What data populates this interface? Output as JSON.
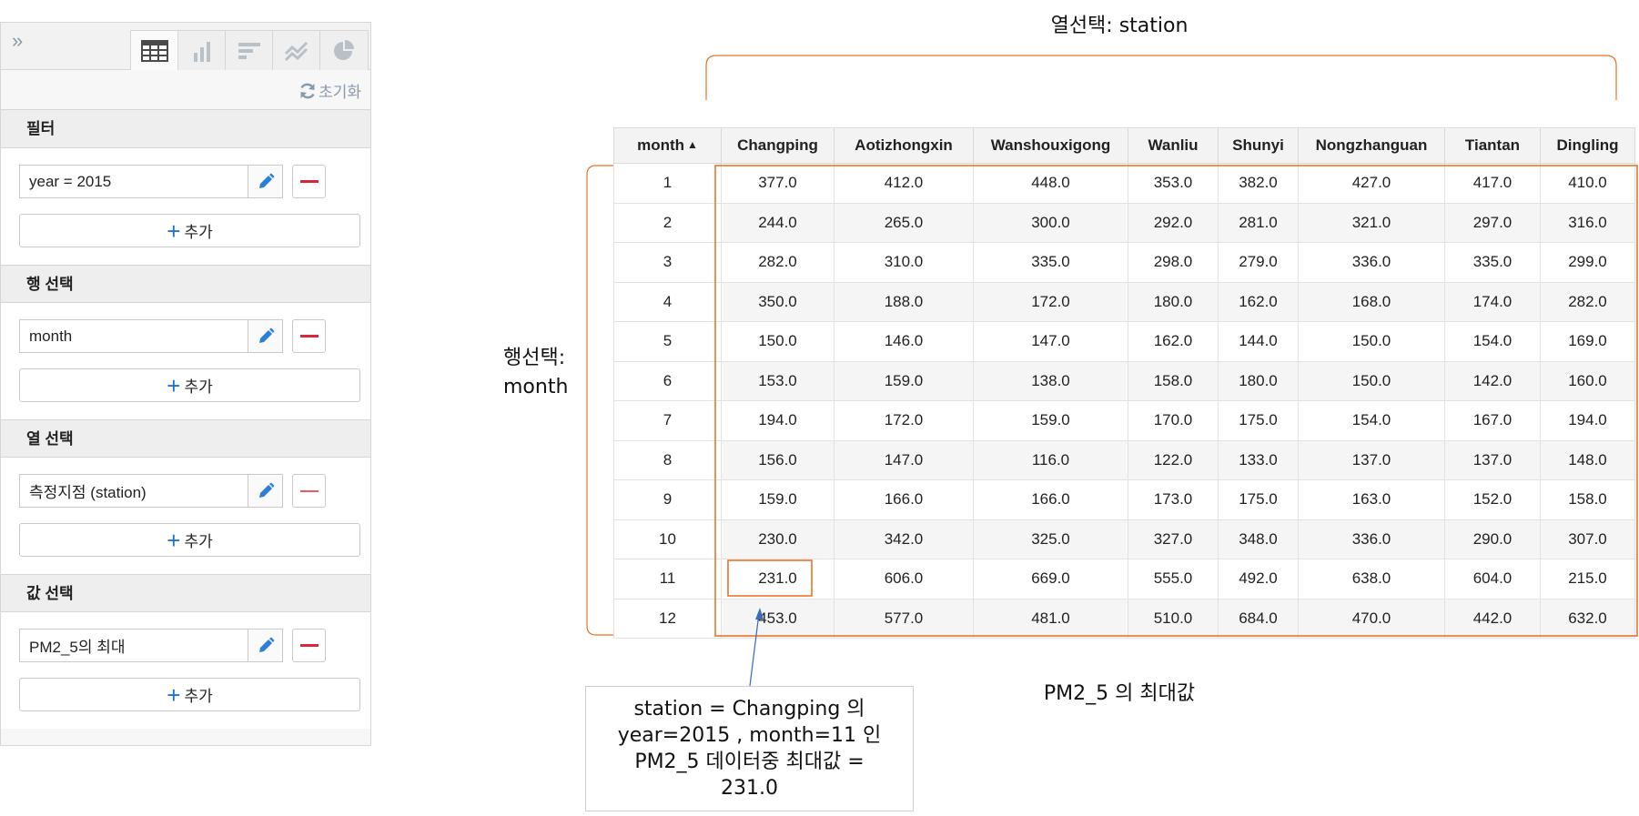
{
  "panel": {
    "collapse_icon": "double-chevron-right-icon",
    "view_tabs": [
      {
        "icon": "table-icon",
        "active": true
      },
      {
        "icon": "bar-chart-icon",
        "active": false
      },
      {
        "icon": "horizontal-bar-icon",
        "active": false
      },
      {
        "icon": "line-chart-icon",
        "active": false
      },
      {
        "icon": "pie-chart-icon",
        "active": false
      }
    ],
    "reset_label": "초기화",
    "add_label": "추가",
    "sections": [
      {
        "title": "필터",
        "field": "year = 2015"
      },
      {
        "title": "행 선택",
        "field": "month"
      },
      {
        "title": "열 선택",
        "field": "측정지점 (station)"
      },
      {
        "title": "값 선택",
        "field": "PM2_5의 최대"
      }
    ]
  },
  "table": {
    "headers": [
      "month",
      "Changping",
      "Aotizhongxin",
      "Wanshouxigong",
      "Wanliu",
      "Shunyi",
      "Nongzhanguan",
      "Tiantan",
      "Dingling"
    ],
    "sort_indicator": "▲",
    "rows": [
      [
        "1",
        "377.0",
        "412.0",
        "448.0",
        "353.0",
        "382.0",
        "427.0",
        "417.0",
        "410.0"
      ],
      [
        "2",
        "244.0",
        "265.0",
        "300.0",
        "292.0",
        "281.0",
        "321.0",
        "297.0",
        "316.0"
      ],
      [
        "3",
        "282.0",
        "310.0",
        "335.0",
        "298.0",
        "279.0",
        "336.0",
        "335.0",
        "299.0"
      ],
      [
        "4",
        "350.0",
        "188.0",
        "172.0",
        "180.0",
        "162.0",
        "168.0",
        "174.0",
        "282.0"
      ],
      [
        "5",
        "150.0",
        "146.0",
        "147.0",
        "162.0",
        "144.0",
        "150.0",
        "154.0",
        "169.0"
      ],
      [
        "6",
        "153.0",
        "159.0",
        "138.0",
        "158.0",
        "180.0",
        "150.0",
        "142.0",
        "160.0"
      ],
      [
        "7",
        "194.0",
        "172.0",
        "159.0",
        "170.0",
        "175.0",
        "154.0",
        "167.0",
        "194.0"
      ],
      [
        "8",
        "156.0",
        "147.0",
        "116.0",
        "122.0",
        "133.0",
        "137.0",
        "137.0",
        "148.0"
      ],
      [
        "9",
        "159.0",
        "166.0",
        "166.0",
        "173.0",
        "175.0",
        "163.0",
        "152.0",
        "158.0"
      ],
      [
        "10",
        "230.0",
        "342.0",
        "325.0",
        "327.0",
        "348.0",
        "336.0",
        "290.0",
        "307.0"
      ],
      [
        "11",
        "231.0",
        "606.0",
        "669.0",
        "555.0",
        "492.0",
        "638.0",
        "604.0",
        "215.0"
      ],
      [
        "12",
        "453.0",
        "577.0",
        "481.0",
        "510.0",
        "684.0",
        "470.0",
        "442.0",
        "632.0"
      ]
    ]
  },
  "annotations": {
    "column_label": "열선택: station",
    "row_label_line1": "행선택:",
    "row_label_line2": "month",
    "value_label": "PM2_5 의 최대값",
    "callout_line1": "station = Changping 의",
    "callout_line2": "year=2015 , month=11 인",
    "callout_line3": "PM2_5 데이터중 최대값 =",
    "callout_line4": "231.0",
    "highlight_color": "#e8742a"
  }
}
